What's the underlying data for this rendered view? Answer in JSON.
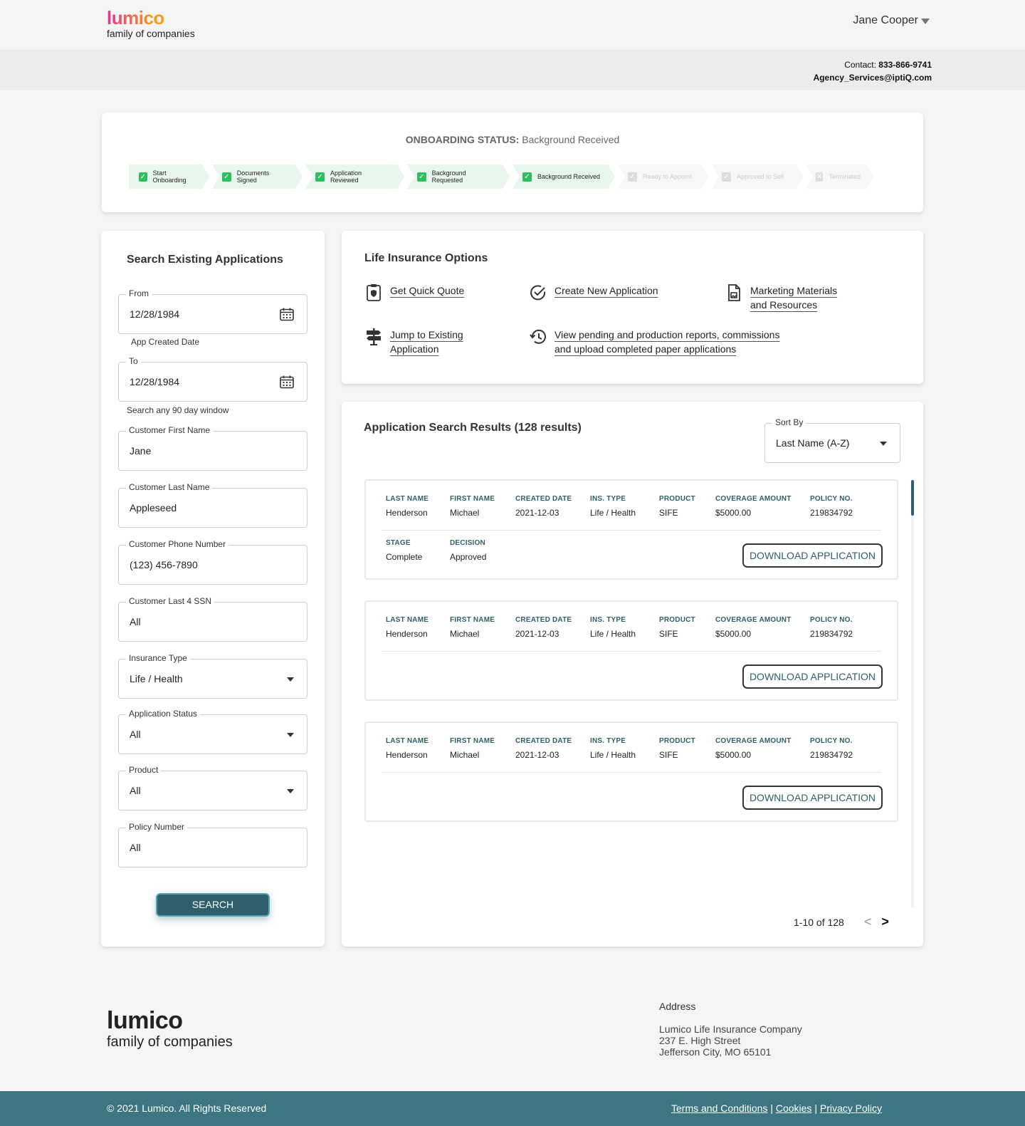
{
  "header": {
    "logo_brand": "lumico",
    "logo_sub": "family of companies",
    "user_name": "Jane Cooper"
  },
  "contact": {
    "label": "Contact:",
    "phone": "833-866-9741",
    "email": "Agency_Services@iptiQ.com"
  },
  "onboarding": {
    "title_label": "ONBOARDING STATUS:",
    "title_value": "Background Received",
    "steps": [
      {
        "label": "Start Onboarding",
        "done": true
      },
      {
        "label": "Documents Signed",
        "done": true
      },
      {
        "label": "Application Reviewed",
        "done": true
      },
      {
        "label": "Background Requested",
        "done": true
      },
      {
        "label": "Background Received",
        "done": true
      },
      {
        "label": "Ready to Appoint",
        "done": false
      },
      {
        "label": "Approved to Sell",
        "done": false
      },
      {
        "label": "Terminated",
        "done": false
      }
    ]
  },
  "search": {
    "title": "Search Existing Applications",
    "from_label": "From",
    "from_value": "12/28/1984",
    "from_helper": "App Created Date",
    "to_label": "To",
    "to_value": "12/28/1984",
    "to_helper": "Search any 90 day window",
    "first_name_label": "Customer First Name",
    "first_name_value": "Jane",
    "last_name_label": "Customer Last Name",
    "last_name_value": "Appleseed",
    "phone_label": "Customer Phone Number",
    "phone_value": "(123) 456-7890",
    "ssn_label": "Customer Last 4 SSN",
    "ssn_value": "All",
    "ins_type_label": "Insurance Type",
    "ins_type_value": "Life / Health",
    "app_status_label": "Application Status",
    "app_status_value": "All",
    "product_label": "Product",
    "product_value": "All",
    "policy_label": "Policy Number",
    "policy_value": "All",
    "button": "SEARCH"
  },
  "options": {
    "title": "Life Insurance Options",
    "quick_quote": "Get Quick Quote",
    "new_app": "Create New Application",
    "marketing_1": "Marketing Materials",
    "marketing_2": "and Resources",
    "jump_1": "Jump to Existing",
    "jump_2": "Application",
    "reports_1": "View pending and production reports, commissions",
    "reports_2": "and upload completed paper applications"
  },
  "results": {
    "title": "Application Search Results (128 results)",
    "sort_label": "Sort By",
    "sort_value": "Last Name (A-Z)",
    "headers": {
      "last_name": "LAST NAME",
      "first_name": "FIRST NAME",
      "created": "CREATED DATE",
      "ins_type": "INS. TYPE",
      "product": "PRODUCT",
      "coverage": "COVERAGE AMOUNT",
      "policy": "POLICY NO.",
      "stage": "STAGE",
      "decision": "DECISION"
    },
    "download_label": "DOWNLOAD APPLICATION",
    "rows": [
      {
        "last_name": "Henderson",
        "first_name": "Michael",
        "created": "2021-12-03",
        "ins_type": "Life / Health",
        "product": "SIFE",
        "coverage": "$5000.00",
        "policy": "219834792",
        "stage": "Complete",
        "decision": "Approved"
      },
      {
        "last_name": "Henderson",
        "first_name": "Michael",
        "created": "2021-12-03",
        "ins_type": "Life / Health",
        "product": "SIFE",
        "coverage": "$5000.00",
        "policy": "219834792"
      },
      {
        "last_name": "Henderson",
        "first_name": "Michael",
        "created": "2021-12-03",
        "ins_type": "Life / Health",
        "product": "SIFE",
        "coverage": "$5000.00",
        "policy": "219834792"
      }
    ],
    "pagination": "1-10 of 128",
    "prev": "<",
    "next": ">"
  },
  "footer": {
    "logo_brand": "lumico",
    "logo_sub": "family of companies",
    "address_heading": "Address",
    "address_lines": [
      "Lumico Life Insurance Company",
      "237 E. High Street",
      "Jefferson City, MO 65101"
    ],
    "copyright": "© 2021 Lumico. All Rights Reserved",
    "terms": "Terms and Conditions",
    "cookies": "Cookies",
    "privacy": "Privacy Policy",
    "separator": "|"
  }
}
